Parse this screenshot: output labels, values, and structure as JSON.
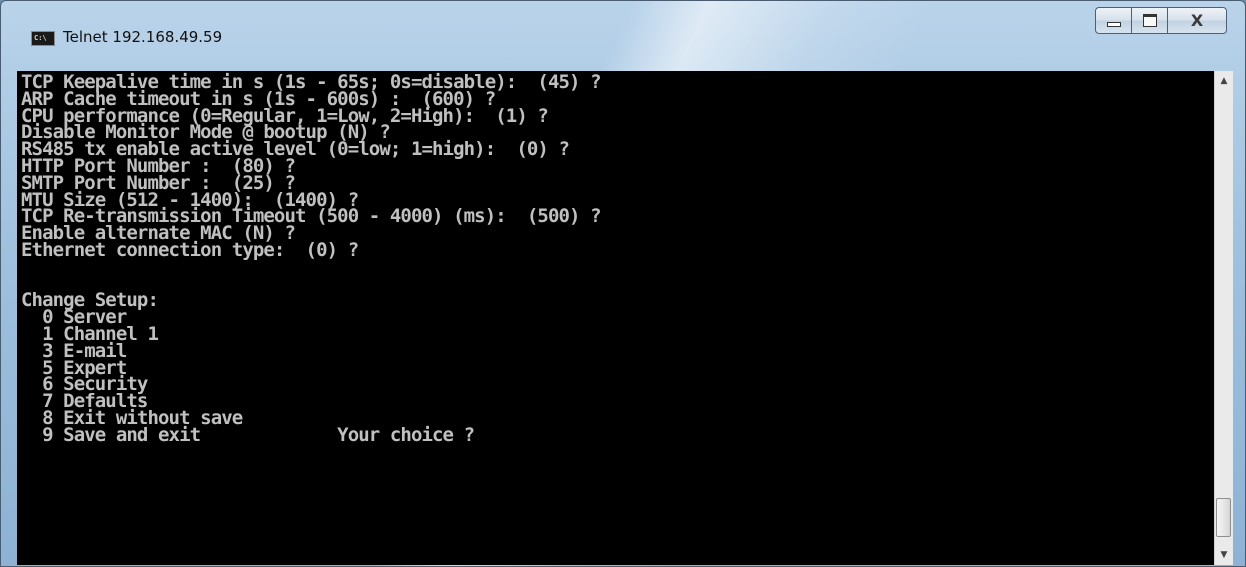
{
  "window": {
    "title": "Telnet 192.168.49.59",
    "icon_label": "C:\\",
    "controls": {
      "minimize": "minimize",
      "maximize": "maximize",
      "close": "X"
    }
  },
  "console": {
    "lines": [
      "TCP Keepalive time in s (1s - 65s; 0s=disable):  (45) ?",
      "ARP Cache timeout in s (1s - 600s) :  (600) ?",
      "CPU performance (0=Regular, 1=Low, 2=High):  (1) ?",
      "Disable Monitor Mode @ bootup (N) ?",
      "RS485 tx enable active level (0=low; 1=high):  (0) ?",
      "HTTP Port Number :  (80) ?",
      "SMTP Port Number :  (25) ?",
      "MTU Size (512 - 1400):  (1400) ?",
      "TCP Re-transmission Timeout (500 - 4000) (ms):  (500) ?",
      "Enable alternate MAC (N) ?",
      "Ethernet connection type:  (0) ?",
      "",
      "",
      "Change Setup:",
      "  0 Server",
      "  1 Channel 1",
      "  3 E-mail",
      "  5 Expert",
      "  6 Security",
      "  7 Defaults",
      "  8 Exit without save",
      "  9 Save and exit             Your choice ?"
    ]
  },
  "scrollbar": {
    "up_arrow": "▲",
    "down_arrow": "▼",
    "position": 0.95
  }
}
